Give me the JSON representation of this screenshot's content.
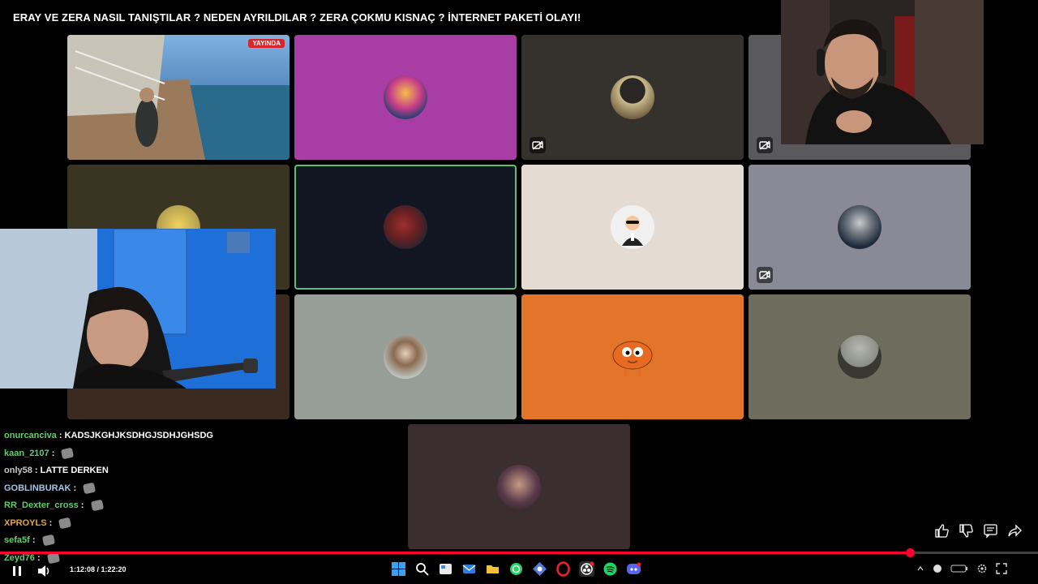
{
  "stream": {
    "title": "ERAY VE ZERA NASIL TANIŞTILAR ? NEDEN AYRILDILAR ? ZERA ÇOKMU KISNAÇ ? İNTERNET PAKETİ OLAYI!"
  },
  "call": {
    "live_badge": "YAYINDA",
    "tiles": [
      {
        "bg": "#5a6470",
        "camera_off": false,
        "speaking": false,
        "has_video": true
      },
      {
        "bg": "#a83da6",
        "camera_off": false,
        "speaking": false,
        "avatar": "#2a3f6e"
      },
      {
        "bg": "#35322e",
        "camera_off": true,
        "speaking": false,
        "avatar": "#6b5a3c"
      },
      {
        "bg": "#5a5a5d",
        "camera_off": true,
        "speaking": false
      },
      {
        "bg": "#3a3522",
        "camera_off": false,
        "speaking": false,
        "avatar": "#b8a250"
      },
      {
        "bg": "#121622",
        "camera_off": false,
        "speaking": true,
        "avatar": "#6a2020"
      },
      {
        "bg": "#e4dbd3",
        "camera_off": false,
        "speaking": false,
        "avatar": "#f0f0f0"
      },
      {
        "bg": "#8a8a96",
        "camera_off": true,
        "speaking": false,
        "avatar": "#1e2a3c"
      },
      {
        "bg": "#3b2a20",
        "camera_off": false,
        "speaking": false
      },
      {
        "bg": "#969e97",
        "camera_off": false,
        "speaking": false,
        "avatar": "#bfc8c4"
      },
      {
        "bg": "#e2752a",
        "camera_off": false,
        "speaking": false,
        "avatar": "#e86a22"
      },
      {
        "bg": "#6e6d5d",
        "camera_off": false,
        "speaking": false,
        "avatar": "#8a8c86"
      },
      {
        "bg": "#3a2e30",
        "camera_off": false,
        "speaking": false,
        "avatar": "#5a3a4a"
      }
    ]
  },
  "chat": {
    "messages": [
      {
        "user": "onurcanciva",
        "user_color": "#5dd16a",
        "text": "KADSJKGHJKSDHGJSDHJGHSDG",
        "emote": false
      },
      {
        "user": "kaan_2107",
        "user_color": "#5dd16a",
        "text": "",
        "emote": true
      },
      {
        "user": "only58",
        "user_color": "#c9c9c9",
        "text": "LATTE DERKEN",
        "emote": false
      },
      {
        "user": "GOBLINBURAK",
        "user_color": "#a8c4e0",
        "text": "",
        "emote": true
      },
      {
        "user": "RR_Dexter_cross",
        "user_color": "#5dd16a",
        "text": "",
        "emote": true
      },
      {
        "user": "XPROYLS",
        "user_color": "#e8a33a",
        "text": "",
        "emote": true
      },
      {
        "user": "sefa5f",
        "user_color": "#5dd16a",
        "text": "",
        "emote": true
      },
      {
        "user": "Zeyd76",
        "user_color": "#5dd16a",
        "text": "",
        "emote": true
      }
    ],
    "separator": " : "
  },
  "player": {
    "time": "1:12:08 / 1:22:20",
    "progress_fraction": 0.8766,
    "accent": "#ff0033"
  },
  "icons": {
    "play_pause": "pause-icon",
    "volume": "volume-icon",
    "like": "thumbs-up-icon",
    "dislike": "thumbs-down-icon",
    "comments": "comment-icon",
    "share": "share-icon"
  }
}
